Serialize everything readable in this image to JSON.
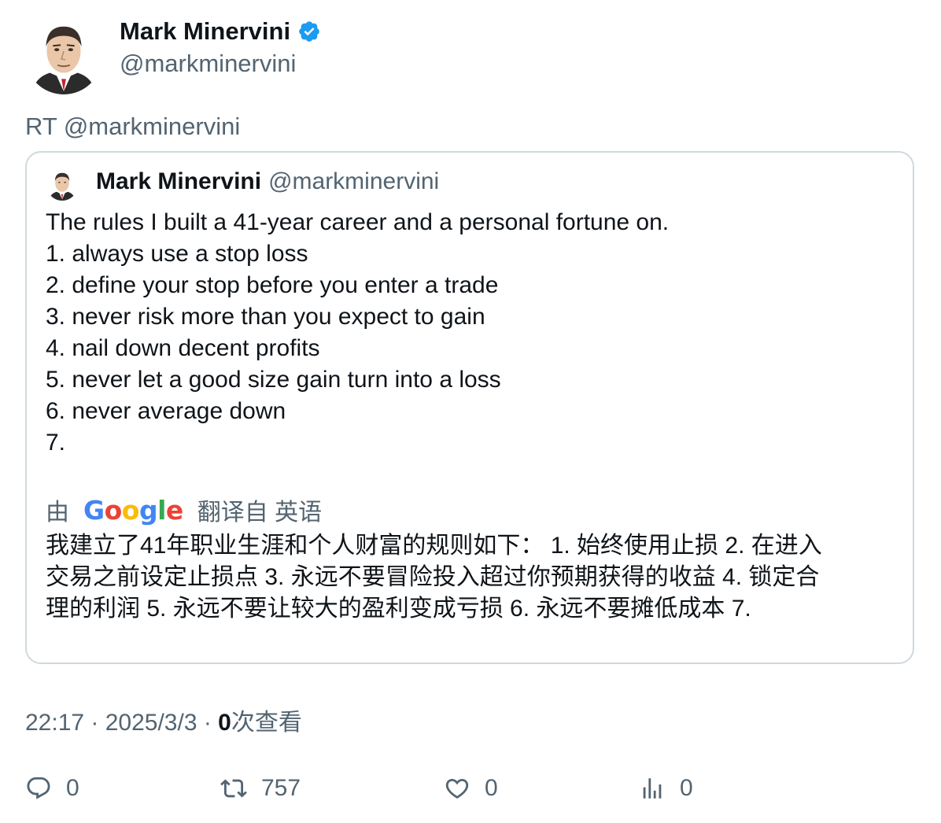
{
  "author": {
    "name": "Mark Minervini",
    "handle": "@markminervini",
    "verified": true
  },
  "retweet_line": "RT @markminervini",
  "quoted": {
    "name": "Mark Minervini",
    "handle": "@markminervini",
    "lines": [
      "The rules I built a 41-year career and a personal fortune on.",
      "1. always use a stop loss",
      "2. define your stop before you enter a trade",
      "3. never risk more than you expect to gain",
      "4. nail down decent profits",
      "5. never let a good size gain turn into a loss",
      "6. never average down",
      "7."
    ],
    "translate_prefix": "由",
    "translate_logo": "Google",
    "translate_suffix": "翻译自 英语",
    "translated_lines": [
      "我建立了41年职业生涯和个人财富的规则如下： 1. 始终使用止损 2. 在进入",
      "交易之前设定止损点 3. 永远不要冒险投入超过你预期获得的收益 4. 锁定合",
      "理的利润 5. 永远不要让较大的盈利变成亏损 6. 永远不要摊低成本 7."
    ]
  },
  "meta": {
    "time_date": "22:17 · 2025/3/3 · ",
    "views_count": "0",
    "views_label": "次查看"
  },
  "actions": {
    "reply": "0",
    "retweet": "757",
    "like": "0",
    "views": "0"
  },
  "colors": {
    "text": "#0f1419",
    "secondary": "#536471",
    "border": "#cfd9de",
    "verified_blue": "#1d9bf0"
  }
}
